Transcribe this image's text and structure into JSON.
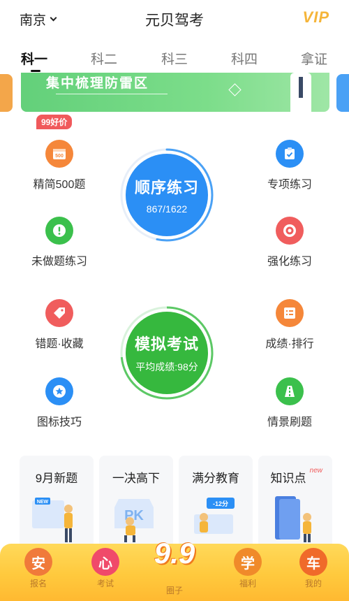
{
  "header": {
    "city": "南京",
    "title": "元贝驾考",
    "vip_label": "VIP"
  },
  "tabs": [
    {
      "label": "科一",
      "active": true
    },
    {
      "label": "科二",
      "active": false
    },
    {
      "label": "科三",
      "active": false
    },
    {
      "label": "科四",
      "active": false
    },
    {
      "label": "拿证",
      "active": false
    }
  ],
  "banner": {
    "text": "集中梳理防雷区"
  },
  "practice": {
    "badge": "99好价",
    "left": [
      {
        "label": "精简500题",
        "icon": "500-icon",
        "color": "#f5873a"
      },
      {
        "label": "未做题练习",
        "icon": "exclamation-icon",
        "color": "#3bc04c"
      },
      {
        "label": "错题·收藏",
        "icon": "tag-icon",
        "color": "#f05d5d"
      },
      {
        "label": "图标技巧",
        "icon": "star-icon",
        "color": "#2b8ff5"
      }
    ],
    "right": [
      {
        "label": "专项练习",
        "icon": "clipboard-icon",
        "color": "#2b8ff5"
      },
      {
        "label": "强化练习",
        "icon": "target-icon",
        "color": "#f05d5d"
      },
      {
        "label": "成绩·排行",
        "icon": "list-icon",
        "color": "#f5873a"
      },
      {
        "label": "情景刷题",
        "icon": "road-icon",
        "color": "#3bc04c"
      }
    ],
    "sequential": {
      "title": "顺序练习",
      "progress_text": "867/1622",
      "done": 867,
      "total": 1622,
      "color": "#2b8ff5"
    },
    "mock_exam": {
      "title": "模拟考试",
      "avg_text": "平均成绩:98分",
      "color": "#36b83e"
    }
  },
  "cards": [
    {
      "title": "9月新题",
      "tag": ""
    },
    {
      "title": "一决高下",
      "tag": ""
    },
    {
      "title": "满分教育",
      "tag": ""
    },
    {
      "title": "知识点",
      "tag": "new"
    }
  ],
  "card_art": {
    "new_label": "NEW",
    "pk_label": "PK",
    "score_label": "-12分"
  },
  "bottom_nav": [
    {
      "label": "报名",
      "bubble": "安",
      "color": "#f07a3a"
    },
    {
      "label": "考试",
      "bubble": "心",
      "color": "#f04a6a"
    },
    {
      "label": "圈子",
      "bubble": "9.9",
      "color": "#ffffff"
    },
    {
      "label": "福利",
      "bubble": "学",
      "color": "#f08a2a"
    },
    {
      "label": "我的",
      "bubble": "车",
      "color": "#f06a2a"
    }
  ]
}
